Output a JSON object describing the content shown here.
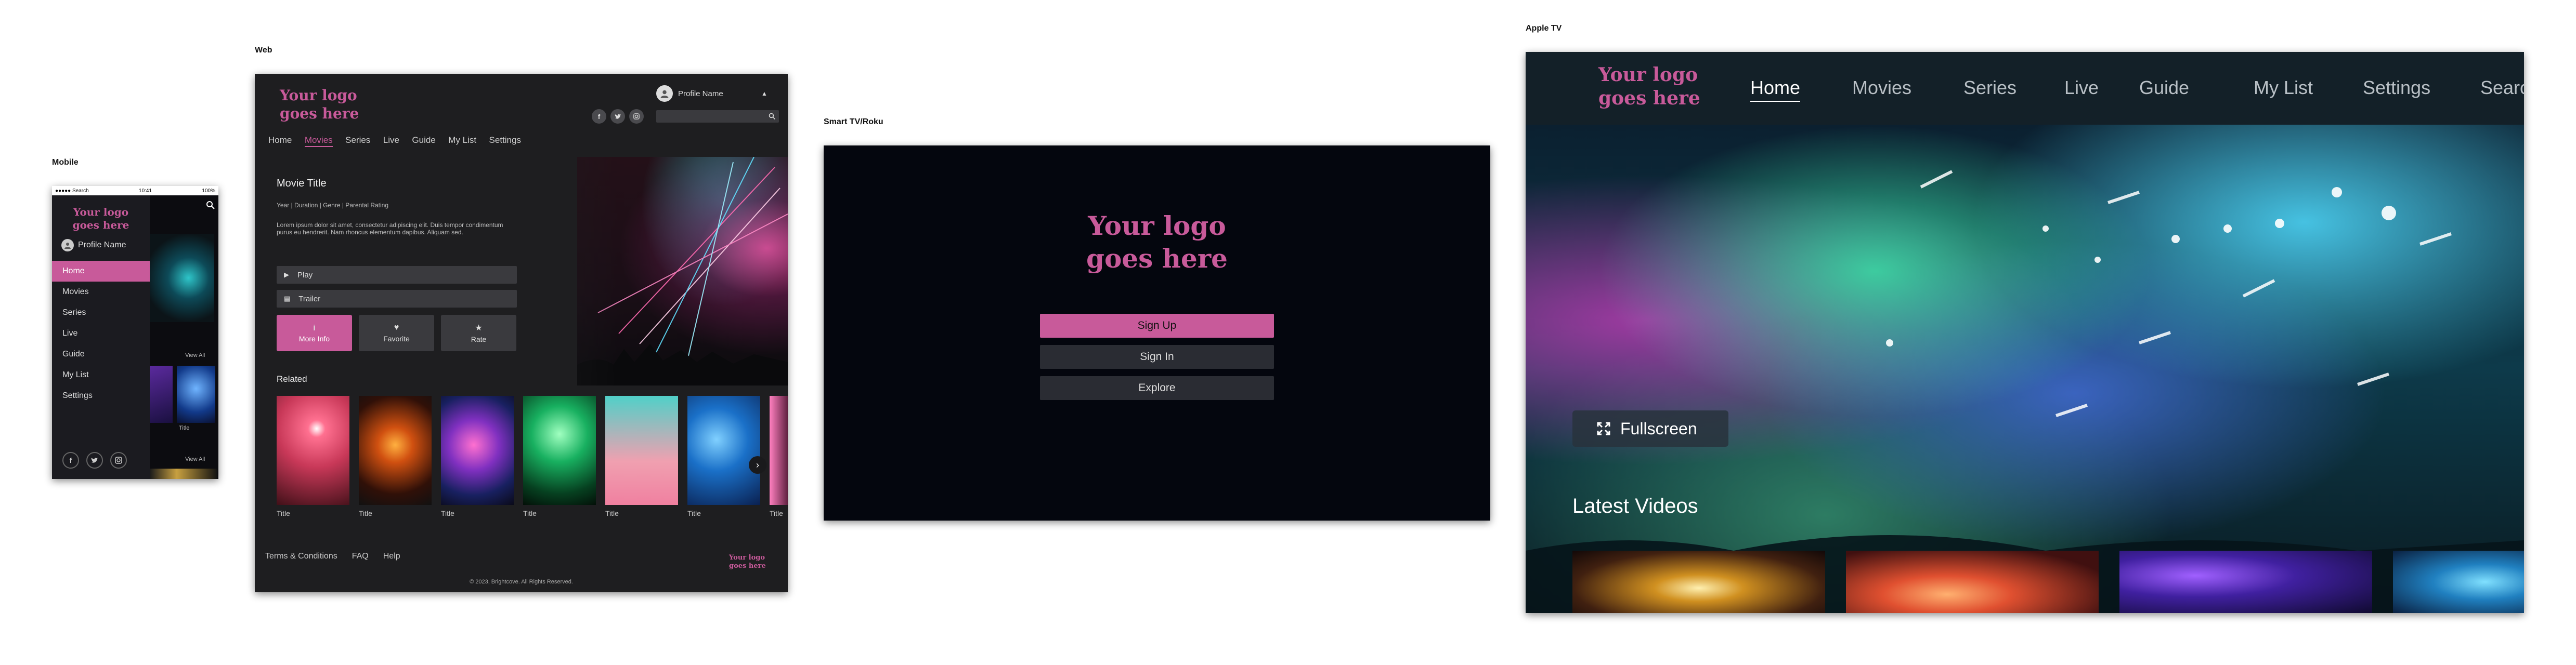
{
  "labels": {
    "mobile": "Mobile",
    "web": "Web",
    "smart_tv": "Smart TV/Roku",
    "apple_tv": "Apple TV"
  },
  "colors": {
    "accent": "#c85a9a",
    "background": "#ffffff",
    "panel_dark": "#1e1e20",
    "tv_bg": "#04060e"
  },
  "mobile": {
    "status": {
      "carrier": "●●●●● Search",
      "time": "10:41",
      "battery": "100%"
    },
    "logo_line1": "Your logo",
    "logo_line2": "goes here",
    "profile_name": "Profile Name",
    "nav": [
      "Home",
      "Movies",
      "Series",
      "Live",
      "Guide",
      "My List",
      "Settings"
    ],
    "active_nav": "Home",
    "view_all_1": "View All",
    "view_all_2": "View All",
    "card_title": "Title",
    "social_icons": [
      "facebook-icon",
      "twitter-icon",
      "instagram-icon"
    ]
  },
  "web": {
    "logo_line1": "Your logo",
    "logo_line2": "goes here",
    "profile_name": "Profile Name",
    "nav": [
      "Home",
      "Movies",
      "Series",
      "Live",
      "Guide",
      "My List",
      "Settings"
    ],
    "active_nav": "Movies",
    "movie_title": "Movie Title",
    "meta": "Year | Duration | Genre | Parental Rating",
    "description": "Lorem ipsum dolor sit amet, consectetur adipiscing elit. Duis tempor condimentum purus eu hendrerit. Nam rhoncus elementum dapibus. Aliquam sed.",
    "play": "Play",
    "trailer": "Trailer",
    "more_info": "More Info",
    "favorite": "Favorite",
    "rate": "Rate",
    "related": "Related",
    "thumb_titles": [
      "Title",
      "Title",
      "Title",
      "Title",
      "Title",
      "Title",
      "Title"
    ],
    "footer_links": [
      "Terms & Conditions",
      "FAQ",
      "Help"
    ],
    "copyright": "© 2023, Brightcove. All Rights Reserved.",
    "footer_logo_line1": "Your logo",
    "footer_logo_line2": "goes here"
  },
  "smart_tv": {
    "logo_line1": "Your logo",
    "logo_line2": "goes here",
    "sign_up": "Sign Up",
    "sign_in": "Sign In",
    "explore": "Explore"
  },
  "apple_tv": {
    "logo_line1": "Your logo",
    "logo_line2": "goes here",
    "nav": [
      "Home",
      "Movies",
      "Series",
      "Live",
      "Guide",
      "My List",
      "Settings",
      "Search"
    ],
    "active_nav": "Home",
    "fullscreen": "Fullscreen",
    "latest_videos": "Latest Videos"
  }
}
